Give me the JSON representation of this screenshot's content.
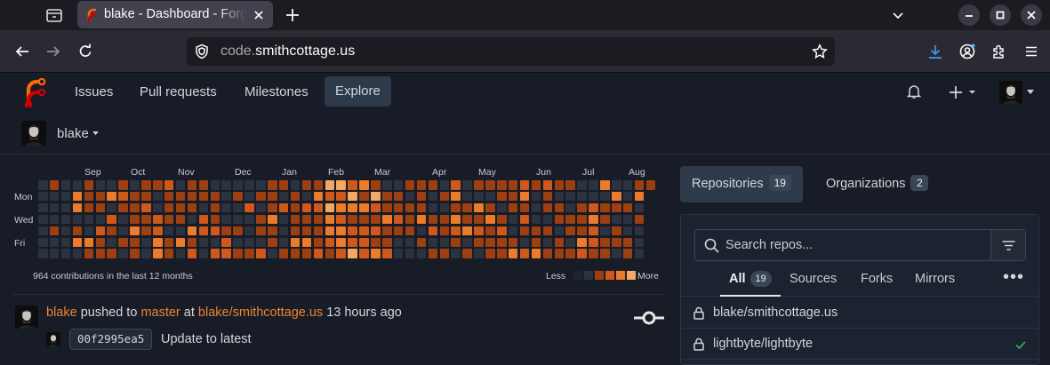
{
  "browser": {
    "tab_title": "blake - Dashboard - Forgejo",
    "url_domain": "code.",
    "url_host": "smithcottage.us"
  },
  "nav": {
    "items": [
      "Issues",
      "Pull requests",
      "Milestones",
      "Explore"
    ],
    "active": "Explore"
  },
  "context": {
    "username": "blake"
  },
  "heatmap": {
    "months": [
      "Sep",
      "Oct",
      "Nov",
      "Dec",
      "Jan",
      "Feb",
      "Mar",
      "Apr",
      "May",
      "Jun",
      "Jul",
      "Aug"
    ],
    "day_labels": [
      "Mon",
      "Wed",
      "Fri"
    ],
    "summary": "964 contributions in the last 12 months",
    "legend_less": "Less",
    "legend_more": "More",
    "level_colors": [
      "#2b3340",
      "#9e3f12",
      "#d1581b",
      "#ee7b2a",
      "#f5a864"
    ]
  },
  "feed": {
    "user": "blake",
    "action": "pushed to",
    "branch": "master",
    "preposition": "at",
    "repo": "blake/smithcottage.us",
    "time": "13 hours ago",
    "commit_sha": "00f2995ea5",
    "commit_message": "Update to latest"
  },
  "right_panel": {
    "tabs": [
      {
        "label": "Repositories",
        "count": "19"
      },
      {
        "label": "Organizations",
        "count": "2"
      }
    ],
    "search_placeholder": "Search repos...",
    "subtabs": [
      {
        "label": "All",
        "count": "19"
      },
      {
        "label": "Sources"
      },
      {
        "label": "Forks"
      },
      {
        "label": "Mirrors"
      }
    ],
    "repos": [
      {
        "name": "blake/smithcottage.us",
        "private": true,
        "status": ""
      },
      {
        "name": "lightbyte/lightbyte",
        "private": true,
        "status": "success"
      }
    ]
  }
}
